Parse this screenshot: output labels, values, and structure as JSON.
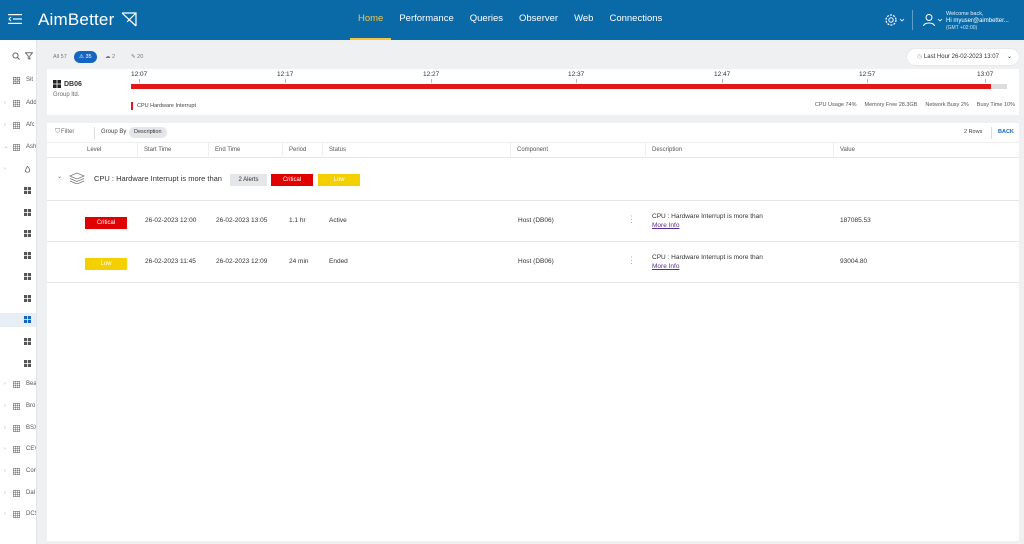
{
  "app": {
    "brand": "AimBetter"
  },
  "nav": [
    {
      "label": "Home",
      "active": true
    },
    {
      "label": "Performance",
      "active": false
    },
    {
      "label": "Queries",
      "active": false
    },
    {
      "label": "Observer",
      "active": false
    },
    {
      "label": "Web",
      "active": false
    },
    {
      "label": "Connections",
      "active": false
    }
  ],
  "user": {
    "welcome": "Welcome back,",
    "greeting": "Hi myuser@aimbetter...",
    "timezone": "(GMT +02:00)"
  },
  "sidebar": {
    "items": [
      {
        "label": "Sit",
        "icon": "grid-icon"
      },
      {
        "label": "Add",
        "icon": "building-icon"
      },
      {
        "label": "Afc",
        "icon": "building-icon"
      },
      {
        "label": "Ash",
        "icon": "building-icon"
      },
      {
        "label": "",
        "icon": "flame-icon"
      },
      {
        "label": "",
        "icon": "windows-icon"
      },
      {
        "label": "",
        "icon": "windows-icon"
      },
      {
        "label": "",
        "icon": "windows-icon"
      },
      {
        "label": "",
        "icon": "windows-icon"
      },
      {
        "label": "",
        "icon": "windows-icon"
      },
      {
        "label": "",
        "icon": "windows-icon"
      },
      {
        "label": "",
        "icon": "windows-icon"
      },
      {
        "label": "",
        "icon": "windows-icon"
      },
      {
        "label": "",
        "icon": "windows-icon"
      },
      {
        "label": "Bea",
        "icon": "building-icon"
      },
      {
        "label": "Bro",
        "icon": "building-icon"
      },
      {
        "label": "BSX",
        "icon": "building-icon"
      },
      {
        "label": "CEV",
        "icon": "building-icon"
      },
      {
        "label": "Con",
        "icon": "building-icon"
      },
      {
        "label": "Dal",
        "icon": "building-icon"
      },
      {
        "label": "DCS",
        "icon": "building-icon"
      }
    ]
  },
  "filters": {
    "all": "All 57",
    "alerts": "35",
    "offline": "2",
    "recommendations": "20",
    "time_range": "Last Hour  26-02-2023 13:07"
  },
  "host": {
    "name": "DB06",
    "group": "Group ltd.",
    "timeline_labels": [
      "12:07",
      "12:17",
      "12:27",
      "12:37",
      "12:47",
      "12:57",
      "13:07"
    ],
    "alert_legend": "CPU Hardware Interrupt",
    "stats": [
      "CPU Usage  74%",
      "Memory Free  28.3GB",
      "Network Busy  2%",
      "Busy Time  10%"
    ]
  },
  "grid": {
    "filter_label": "Filter",
    "group_by_label": "Group By",
    "group_by_value": "Description",
    "rows_count": "2 Rows",
    "back_label": "BACK",
    "columns": [
      "Level",
      "Start Time",
      "End Time",
      "Period",
      "Status",
      "Component",
      "Description",
      "Value"
    ],
    "group": {
      "title": "CPU : Hardware Interrupt is more than",
      "alerts_count": "2 Alerts",
      "badges": [
        {
          "label": "Critical",
          "color": "#e00000"
        },
        {
          "label": "Low",
          "color": "#f5d000"
        }
      ]
    },
    "rows": [
      {
        "level": "Critical",
        "level_color": "#e00000",
        "start": "26-02-2023 12:00",
        "end": "26-02-2023 13:05",
        "period": "1.1 hr",
        "status": "Active",
        "component": "Host (DB06)",
        "description": "CPU : Hardware Interrupt is more than",
        "more": "More Info",
        "value": "187085.53"
      },
      {
        "level": "Low",
        "level_color": "#f5d000",
        "start": "26-02-2023 11:45",
        "end": "26-02-2023 12:09",
        "period": "24 min",
        "status": "Ended",
        "component": "Host (DB06)",
        "description": "CPU : Hardware Interrupt is more than",
        "more": "More Info",
        "value": "93004.80"
      }
    ]
  },
  "colors": {
    "topbar": "#0a6aa8",
    "accent": "#f5c542",
    "critical": "#e00000",
    "low": "#f5d000",
    "link": "#5a2d91"
  }
}
